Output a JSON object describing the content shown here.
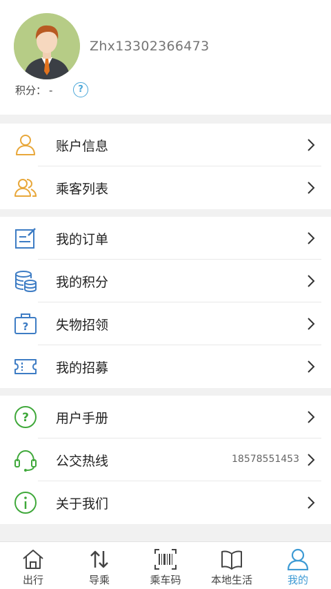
{
  "profile": {
    "username": "Zhx13302366473",
    "points_label": "积分：",
    "points_value": "-"
  },
  "groups": [
    {
      "items": [
        {
          "label": "账户信息",
          "icon": "user-icon",
          "color": "#e8a73a"
        },
        {
          "label": "乘客列表",
          "icon": "passengers-icon",
          "color": "#e8a73a"
        }
      ]
    },
    {
      "items": [
        {
          "label": "我的订单",
          "icon": "order-icon",
          "color": "#3d7cc4"
        },
        {
          "label": "我的积分",
          "icon": "database-icon",
          "color": "#3d7cc4"
        },
        {
          "label": "失物招领",
          "icon": "lost-found-icon",
          "color": "#3d7cc4"
        },
        {
          "label": "我的招募",
          "icon": "ticket-icon",
          "color": "#3d7cc4"
        }
      ]
    },
    {
      "items": [
        {
          "label": "用户手册",
          "icon": "question-icon",
          "color": "#3fa83a"
        },
        {
          "label": "公交热线",
          "icon": "headset-icon",
          "color": "#3fa83a",
          "extra": "18578551453"
        },
        {
          "label": "关于我们",
          "icon": "info-icon",
          "color": "#3fa83a"
        }
      ]
    }
  ],
  "tabs": [
    {
      "label": "出行",
      "icon": "home-icon",
      "active": false
    },
    {
      "label": "导乘",
      "icon": "transfer-arrows-icon",
      "active": false
    },
    {
      "label": "乘车码",
      "icon": "barcode-icon",
      "active": false
    },
    {
      "label": "本地生活",
      "icon": "book-icon",
      "active": false
    },
    {
      "label": "我的",
      "icon": "profile-icon",
      "active": true
    }
  ],
  "colors": {
    "accent_blue": "#3d9ad4",
    "orange": "#e8a73a",
    "blue": "#3d7cc4",
    "green": "#3fa83a"
  }
}
